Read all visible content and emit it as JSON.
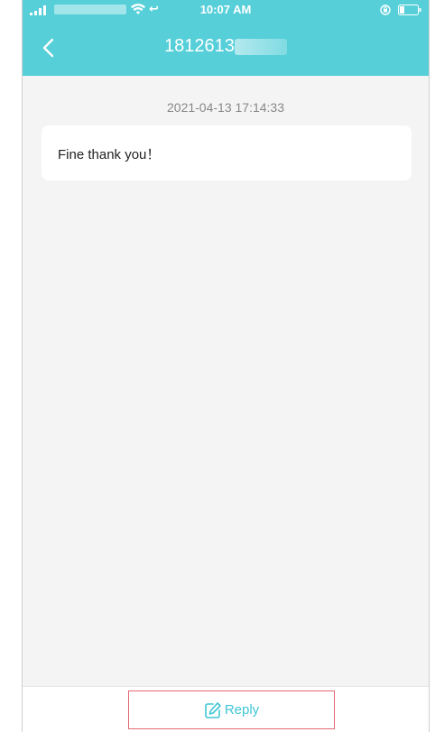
{
  "status_bar": {
    "time": "10:07 AM",
    "call_forward_glyph": "↩"
  },
  "nav": {
    "title": "1812613",
    "back_icon": "chevron-left-icon"
  },
  "message": {
    "timestamp": "2021-04-13 17:14:33",
    "text": "Fine thank you！"
  },
  "footer": {
    "reply_label": "Reply",
    "reply_icon": "edit-icon"
  },
  "colors": {
    "header": "#56cfd9",
    "accent": "#3fc6d3",
    "background": "#f4f4f4",
    "highlight_border": "#e06a72"
  }
}
